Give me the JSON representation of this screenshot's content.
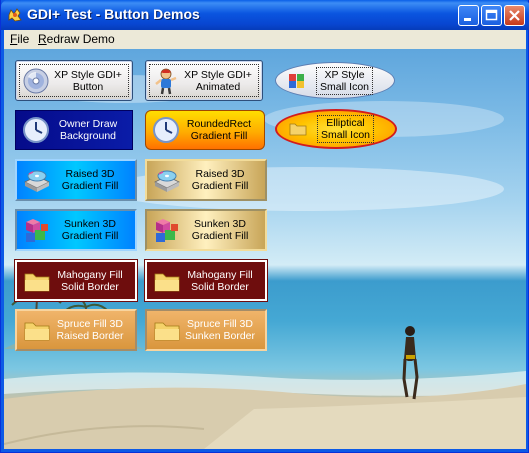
{
  "window": {
    "title": "GDI+ Test - Button Demos"
  },
  "menu": {
    "file": "File",
    "redraw": "Redraw Demo"
  },
  "buttons": {
    "xp_style": "XP Style GDI+\nButton",
    "xp_animated": "XP Style GDI+\nAnimated",
    "xp_small_icon": "XP Style\nSmall Icon",
    "owner_draw": "Owner Draw\nBackground",
    "rounded_rect": "RoundedRect\nGradient Fill",
    "elliptical": "Elliptical\nSmall Icon",
    "raised_blue": "Raised 3D\nGradient Fill",
    "raised_gold": "Raised 3D\nGradient Fill",
    "sunken_blue": "Sunken 3D\nGradient Fill",
    "sunken_gold": "Sunken 3D\nGradient Fill",
    "mahogany_1": "Mahogany Fill\nSolid Border",
    "mahogany_2": "Mahogany Fill\nSolid Border",
    "spruce_raised": "Spruce Fill 3D\nRaised Border",
    "spruce_sunken": "Spruce Fill 3D\nSunken Border"
  },
  "icons": {
    "xp_style": "cd-disc-icon",
    "xp_animated": "kid-character-icon",
    "xp_small_icon": "colored-cubes-icon",
    "owner_draw": "clock-icon",
    "rounded_rect": "clock-icon",
    "elliptical": "folder-icon",
    "raised": "cd-drive-icon",
    "sunken": "colored-cubes-icon",
    "mahogany": "folder-icon",
    "spruce": "folder-icon"
  },
  "colors": {
    "title_bar": "#0a55e0",
    "mahogany": "#6e0d0d",
    "spruce": "#e3a24f",
    "blue_gradient": "#00c8ff",
    "gold_gradient": "#fff0bf",
    "orange_ellipse": "#ffc400"
  }
}
